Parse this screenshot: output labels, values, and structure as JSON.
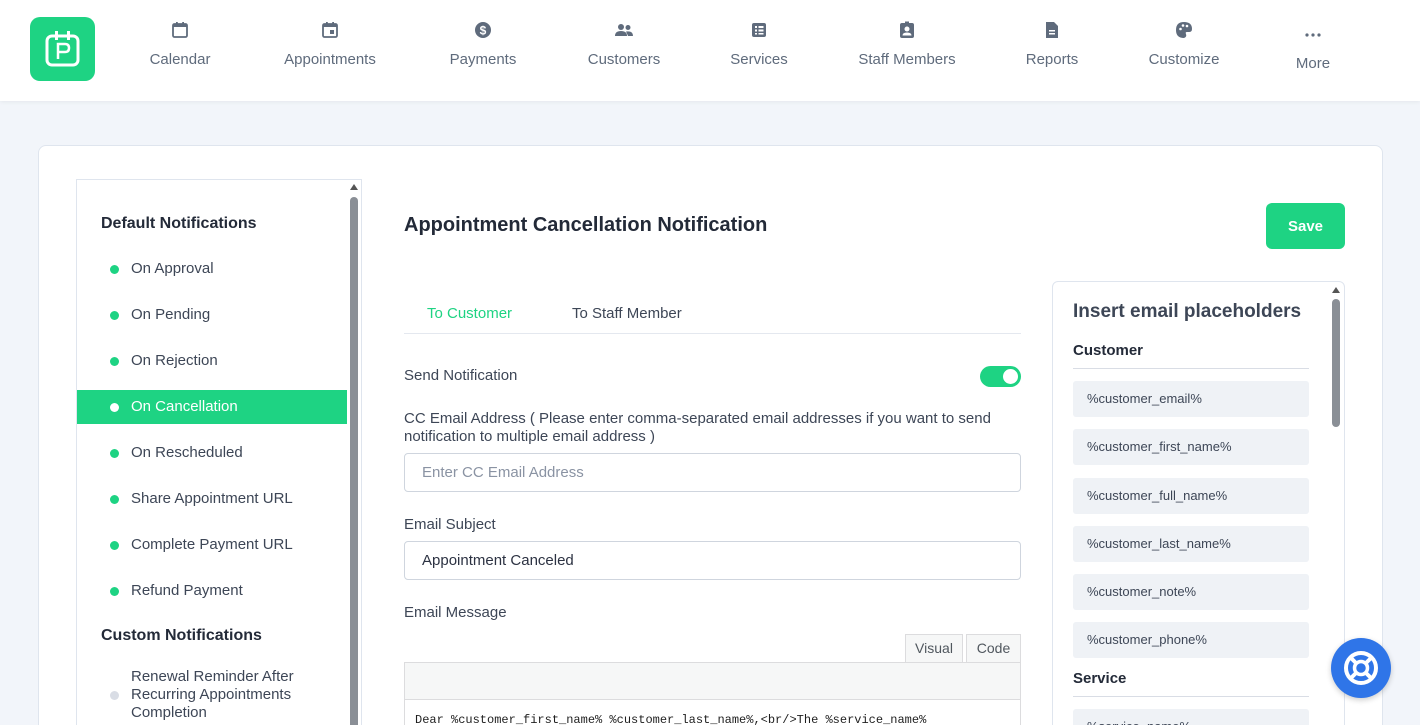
{
  "nav": {
    "items": [
      {
        "label": "Calendar",
        "icon": "calendar-icon"
      },
      {
        "label": "Appointments",
        "icon": "calendar-event-icon"
      },
      {
        "label": "Payments",
        "icon": "dollar-icon"
      },
      {
        "label": "Customers",
        "icon": "users-icon"
      },
      {
        "label": "Services",
        "icon": "list-icon"
      },
      {
        "label": "Staff Members",
        "icon": "id-badge-icon"
      },
      {
        "label": "Reports",
        "icon": "report-icon"
      },
      {
        "label": "Customize",
        "icon": "palette-icon"
      },
      {
        "label": "More",
        "icon": "more-dots-icon"
      }
    ]
  },
  "sidebar": {
    "default_heading": "Default Notifications",
    "default_items": [
      {
        "label": "On Approval",
        "active": false
      },
      {
        "label": "On Pending",
        "active": false
      },
      {
        "label": "On Rejection",
        "active": false
      },
      {
        "label": "On Cancellation",
        "active": true
      },
      {
        "label": "On Rescheduled",
        "active": false
      },
      {
        "label": "Share Appointment URL",
        "active": false
      },
      {
        "label": "Complete Payment URL",
        "active": false
      },
      {
        "label": "Refund Payment",
        "active": false
      }
    ],
    "custom_heading": "Custom Notifications",
    "custom_items": [
      {
        "label": "Renewal Reminder After Recurring Appointments Completion"
      }
    ]
  },
  "main": {
    "title": "Appointment Cancellation Notification",
    "save_label": "Save",
    "tabs": [
      {
        "label": "To Customer",
        "active": true
      },
      {
        "label": "To Staff Member",
        "active": false
      }
    ],
    "send_notification_label": "Send Notification",
    "send_notification_on": true,
    "cc_label": "CC Email Address ( Please enter comma-separated email addresses if you want to send notification to multiple email address )",
    "cc_placeholder": "Enter CC Email Address",
    "cc_value": "",
    "subject_label": "Email Subject",
    "subject_value": "Appointment Canceled",
    "message_label": "Email Message",
    "editor_tabs": [
      "Visual",
      "Code"
    ],
    "editor_active_tab": "Code",
    "message_text": "Dear %customer_first_name% %customer_last_name%,<br/>The %service_name%"
  },
  "placeholders": {
    "title": "Insert email placeholders",
    "groups": [
      {
        "name": "Customer",
        "items": [
          "%customer_email%",
          "%customer_first_name%",
          "%customer_full_name%",
          "%customer_last_name%",
          "%customer_note%",
          "%customer_phone%"
        ]
      },
      {
        "name": "Service",
        "items": [
          "%service_name%"
        ]
      }
    ]
  },
  "colors": {
    "accent": "#1ed383",
    "help_button": "#2f75e8"
  }
}
